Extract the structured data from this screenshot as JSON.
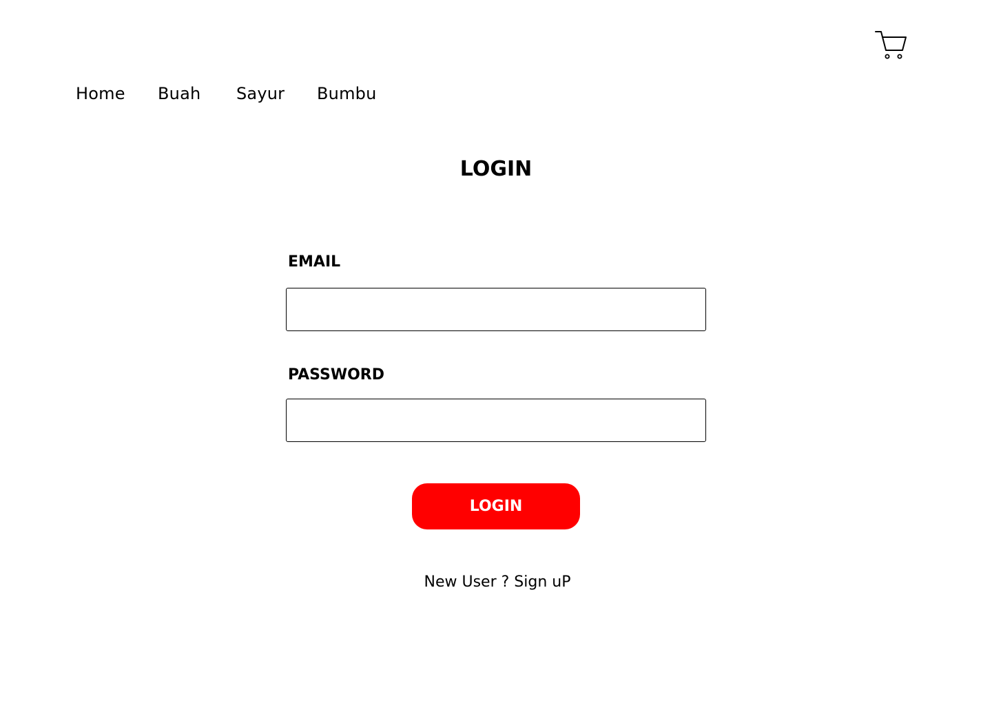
{
  "header": {
    "cart_icon": "cart-icon"
  },
  "nav": {
    "items": [
      {
        "label": "Home"
      },
      {
        "label": "Buah"
      },
      {
        "label": "Sayur"
      },
      {
        "label": "Bumbu"
      }
    ]
  },
  "login_form": {
    "title": "LOGIN",
    "email_label": "EMAIL",
    "email_value": "",
    "password_label": "PASSWORD",
    "password_value": "",
    "submit_label": "LOGIN",
    "signup_text": "New User ? Sign uP"
  },
  "colors": {
    "accent": "#ff0000",
    "text": "#000000",
    "background": "#ffffff"
  }
}
